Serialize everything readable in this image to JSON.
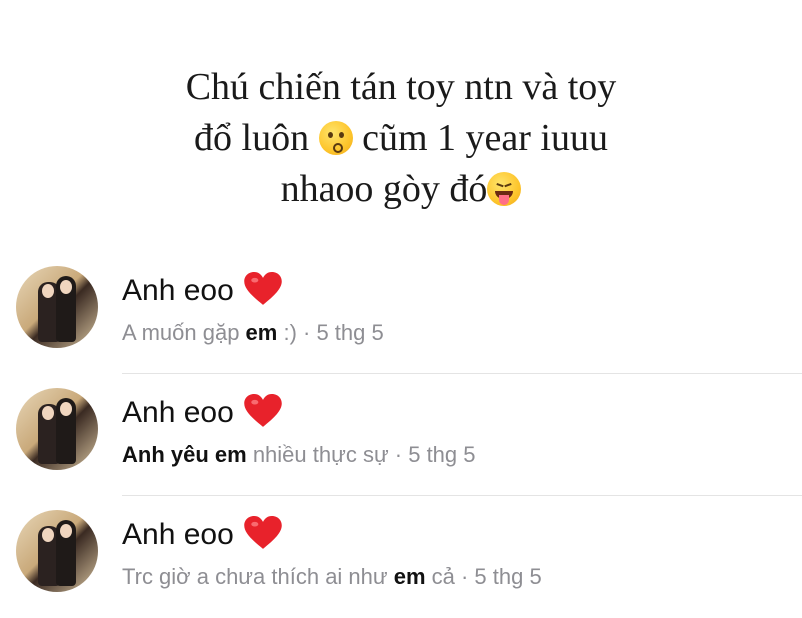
{
  "caption": {
    "line1": "Chú chiến tán toy ntn và toy",
    "line2_a": "đổ luôn ",
    "line2_emoji": "kissing-face-emoji",
    "line2_b": " cũm 1 year iuuu",
    "line3_a": "nhaoo gòy đó",
    "line3_emoji": "squinting-tongue-face-emoji"
  },
  "chats": [
    {
      "name": "Anh eoo",
      "heart_icon": "red-heart-icon",
      "preview_a": "A muốn gặp ",
      "preview_bold": "em",
      "preview_b": " :) · 5 thg 5"
    },
    {
      "name": "Anh eoo",
      "heart_icon": "red-heart-icon",
      "preview_bold_a": "Anh yêu em",
      "preview_b": " nhiều thực sự · 5 thg 5"
    },
    {
      "name": "Anh eoo",
      "heart_icon": "red-heart-icon",
      "preview_a": "Trc giờ a chưa thích ai như ",
      "preview_bold": "em",
      "preview_b": " cả · 5 thg 5"
    }
  ],
  "colors": {
    "heart": "#e8222b",
    "muted_text": "#8e8e93",
    "text": "#111111"
  }
}
